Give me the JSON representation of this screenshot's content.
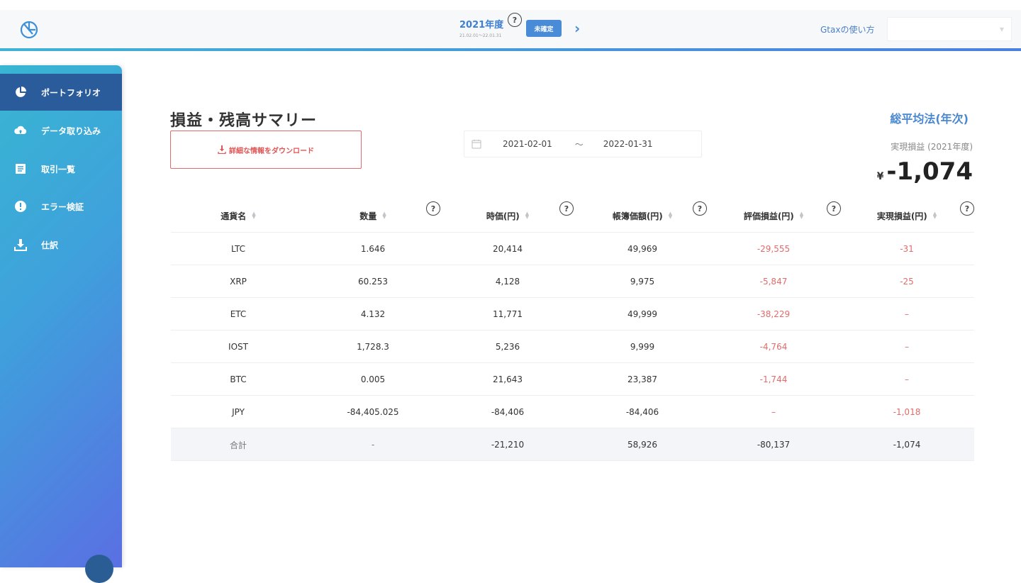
{
  "header": {
    "year_label": "2021年度",
    "year_range": "21.02.01〜22.01.31",
    "status_label": "未確定",
    "next_arrow": "›",
    "howto_label": "Gtaxの使い方",
    "user_select_value": "",
    "help_mark": "?"
  },
  "sidebar": {
    "items": [
      {
        "label": "ポートフォリオ",
        "icon": "pie-chart-icon",
        "active": true
      },
      {
        "label": "データ取り込み",
        "icon": "cloud-upload-icon",
        "active": false
      },
      {
        "label": "取引一覧",
        "icon": "list-icon",
        "active": false
      },
      {
        "label": "エラー検証",
        "icon": "alert-icon",
        "active": false
      },
      {
        "label": "仕訳",
        "icon": "download-icon",
        "active": false
      }
    ]
  },
  "main": {
    "title": "損益・残高サマリー",
    "download_label": "詳細な情報をダウンロード",
    "date_start": "2021-02-01",
    "date_sep": "〜",
    "date_end": "2022-01-31",
    "method": "総平均法(年次)",
    "realized_label": "実現損益 (2021年度)",
    "realized_currency": "¥",
    "realized_value": "-1,074"
  },
  "table": {
    "columns": [
      "通貨名",
      "数量",
      "時価(円)",
      "帳簿価額(円)",
      "評価損益(円)",
      "実現損益(円)"
    ],
    "rows": [
      [
        "LTC",
        "1.646",
        "20,414",
        "49,969",
        "-29,555",
        "-31"
      ],
      [
        "XRP",
        "60.253",
        "4,128",
        "9,975",
        "-5,847",
        "-25"
      ],
      [
        "ETC",
        "4.132",
        "11,771",
        "49,999",
        "-38,229",
        "–"
      ],
      [
        "IOST",
        "1,728.3",
        "5,236",
        "9,999",
        "-4,764",
        "–"
      ],
      [
        "BTC",
        "0.005",
        "21,643",
        "23,387",
        "-1,744",
        "–"
      ],
      [
        "JPY",
        "-84,405.025",
        "-84,406",
        "-84,406",
        "–",
        "-1,018"
      ]
    ],
    "total": [
      "合計",
      "-",
      "-21,210",
      "58,926",
      "-80,137",
      "-1,074"
    ]
  },
  "colors": {
    "accent": "#4a8bd8",
    "negative": "#e26b6b",
    "sidebar_active": "#2a5b9a"
  }
}
